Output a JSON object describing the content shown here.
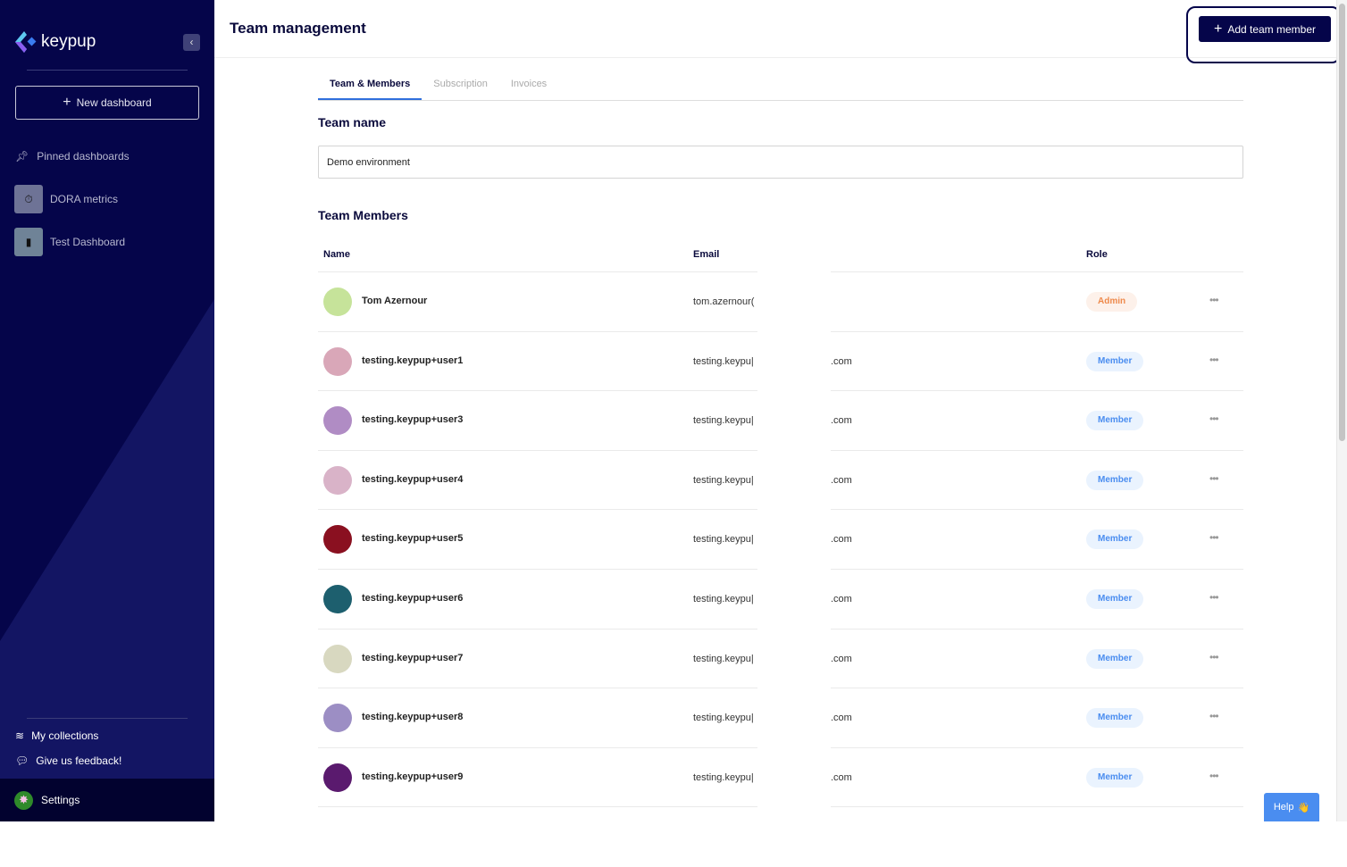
{
  "sidebar": {
    "brand": "keypup",
    "new_dashboard": "New dashboard",
    "pinned_label": "Pinned dashboards",
    "dashboards": [
      {
        "label": "DORA metrics",
        "icon": "stopwatch-icon",
        "color": "#6e7396"
      },
      {
        "label": "Test Dashboard",
        "icon": "file-icon",
        "color": "#6f8397"
      }
    ],
    "collections": "My collections",
    "feedback": "Give us feedback!",
    "settings": "Settings"
  },
  "header": {
    "title": "Team management",
    "add_button": "Add team member"
  },
  "tabs": [
    {
      "label": "Team & Members",
      "active": true
    },
    {
      "label": "Subscription"
    },
    {
      "label": "Invoices"
    }
  ],
  "team_name": {
    "label": "Team name",
    "value": "Demo environment"
  },
  "members": {
    "label": "Team Members",
    "columns": [
      "Name",
      "Email",
      "Role"
    ],
    "rows": [
      {
        "name": "Tom Azernour",
        "email_start": "tom.azernour(",
        "email_end": "",
        "role": "Admin",
        "avatar": "#c6e39a"
      },
      {
        "name": "testing.keypup+user1",
        "email_start": "testing.keypu|",
        "email_end": ".com",
        "role": "Member",
        "avatar": "#d9a7b8"
      },
      {
        "name": "testing.keypup+user3",
        "email_start": "testing.keypu|",
        "email_end": ".com",
        "role": "Member",
        "avatar": "#b08cc4"
      },
      {
        "name": "testing.keypup+user4",
        "email_start": "testing.keypu|",
        "email_end": ".com",
        "role": "Member",
        "avatar": "#d9b3c8"
      },
      {
        "name": "testing.keypup+user5",
        "email_start": "testing.keypu|",
        "email_end": ".com",
        "role": "Member",
        "avatar": "#8a1020"
      },
      {
        "name": "testing.keypup+user6",
        "email_start": "testing.keypu|",
        "email_end": ".com",
        "role": "Member",
        "avatar": "#1d5f6e"
      },
      {
        "name": "testing.keypup+user7",
        "email_start": "testing.keypu|",
        "email_end": ".com",
        "role": "Member",
        "avatar": "#d8d8c0"
      },
      {
        "name": "testing.keypup+user8",
        "email_start": "testing.keypu|",
        "email_end": ".com",
        "role": "Member",
        "avatar": "#9c8ec4"
      },
      {
        "name": "testing.keypup+user9",
        "email_start": "testing.keypu|",
        "email_end": ".com",
        "role": "Member",
        "avatar": "#5a1a6e"
      },
      {
        "name": "",
        "email_start": "",
        "email_end": "",
        "role": "",
        "avatar": "#ffffff"
      }
    ]
  },
  "help": {
    "label": "Help",
    "icon": "wave-hand-icon"
  }
}
